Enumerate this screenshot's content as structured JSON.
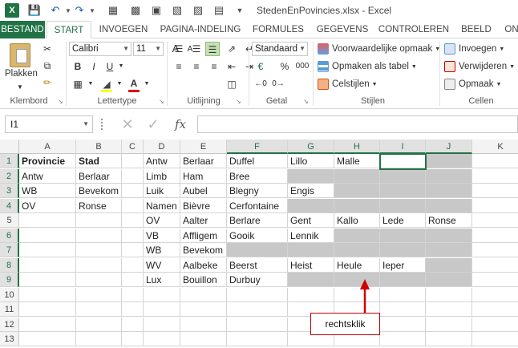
{
  "window": {
    "title": "StedenEnPovincies.xlsx - Excel"
  },
  "qat": {
    "save_icon": "save-icon",
    "undo_icon": "undo-icon",
    "redo_icon": "redo-icon"
  },
  "tabs": [
    "BESTAND",
    "START",
    "INVOEGEN",
    "PAGINA-INDELING",
    "FORMULES",
    "GEGEVENS",
    "CONTROLEREN",
    "BEELD",
    "ON"
  ],
  "ribbon": {
    "clipboard": {
      "paste": "Plakken",
      "label": "Klembord"
    },
    "font": {
      "name": "Calibri",
      "size": "11",
      "bold": "B",
      "italic": "I",
      "underline": "U",
      "grow": "A",
      "shrink": "A",
      "font_color": "A",
      "label": "Lettertype"
    },
    "alignment": {
      "label": "Uitlijning"
    },
    "number": {
      "format": "Standaard",
      "percent": "%",
      "thousands": "000",
      "label": "Getal"
    },
    "styles": {
      "conditional": "Voorwaardelijke opmaak",
      "as_table": "Opmaken als tabel",
      "cell_styles": "Celstijlen",
      "label": "Stijlen"
    },
    "cells": {
      "insert": "Invoegen",
      "delete": "Verwijderen",
      "format": "Opmaak",
      "label": "Cellen"
    }
  },
  "formula_bar": {
    "name_box": "I1",
    "fx": "fx",
    "formula": ""
  },
  "sheet": {
    "columns": [
      "A",
      "B",
      "C",
      "D",
      "E",
      "F",
      "G",
      "H",
      "I",
      "J",
      "K"
    ],
    "rows": [
      "1",
      "2",
      "3",
      "4",
      "5",
      "6",
      "7",
      "8",
      "9",
      "10",
      "11",
      "12",
      "13"
    ],
    "cells": {
      "A1": "Provincie",
      "B1": "Stad",
      "D1": "Antw",
      "E1": "Berlaar",
      "F1": "Duffel",
      "G1": "Lillo",
      "H1": "Malle",
      "A2": "Antw",
      "B2": "Berlaar",
      "D2": "Limb",
      "E2": "Ham",
      "F2": "Bree",
      "A3": "WB",
      "B3": "Bevekom",
      "D3": "Luik",
      "E3": "Aubel",
      "F3": "Blegny",
      "G3": "Engis",
      "A4": "OV",
      "B4": "Ronse",
      "D4": "Namen",
      "E4": "Bièvre",
      "F4": "Cerfontaine",
      "D5": "OV",
      "E5": "Aalter",
      "F5": "Berlare",
      "G5": "Gent",
      "H5": "Kallo",
      "I5": "Lede",
      "J5": "Ronse",
      "D6": "VB",
      "E6": "Affligem",
      "F6": "Gooik",
      "G6": "Lennik",
      "D7": "WB",
      "E7": "Bevekom",
      "D8": "WV",
      "E8": "Aalbeke",
      "F8": "Beerst",
      "G8": "Heist",
      "H8": "Heule",
      "I8": "Ieper",
      "D9": "Lux",
      "E9": "Bouillon",
      "F9": "Durbuy"
    }
  },
  "annotation": {
    "callout": "rechtsklik"
  }
}
